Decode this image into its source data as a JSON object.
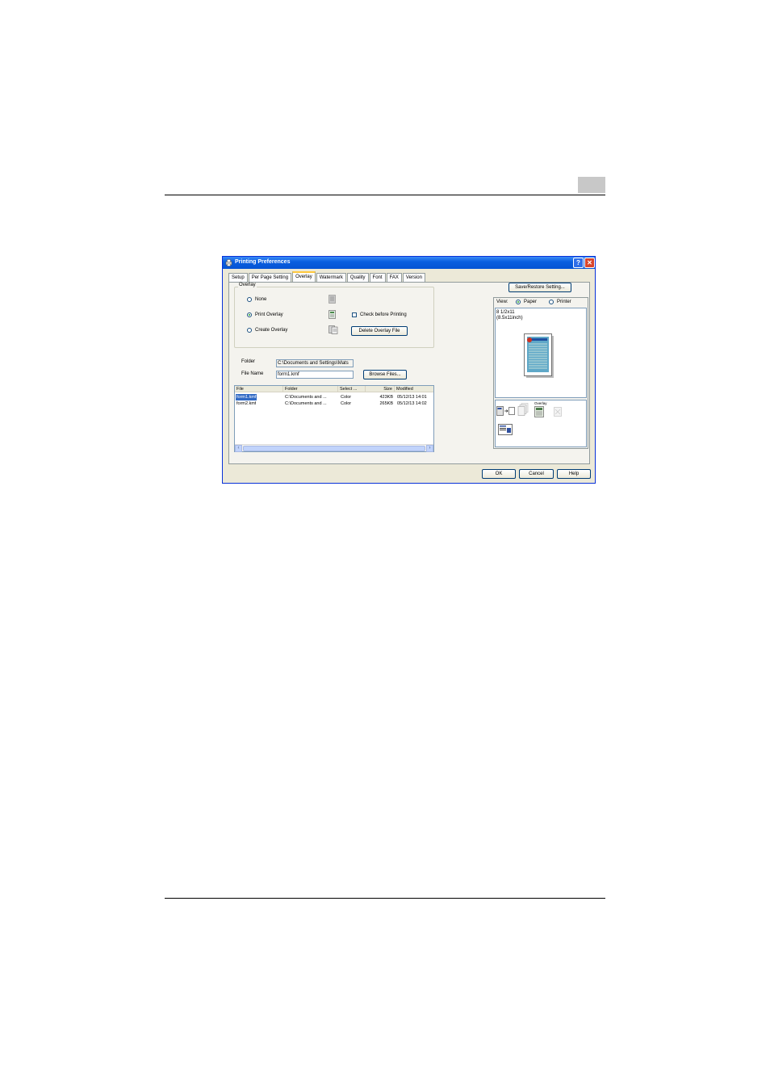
{
  "window": {
    "title": "Printing Preferences",
    "help_label": "?",
    "close_label": "✕"
  },
  "tabs": [
    {
      "label": "Setup"
    },
    {
      "label": "Per Page Setting"
    },
    {
      "label": "Overlay"
    },
    {
      "label": "Watermark"
    },
    {
      "label": "Quality"
    },
    {
      "label": "Font"
    },
    {
      "label": "FAX"
    },
    {
      "label": "Version"
    }
  ],
  "overlay": {
    "group_label": "Overlay",
    "options": [
      {
        "label": "None",
        "selected": false
      },
      {
        "label": "Print Overlay",
        "selected": true
      },
      {
        "label": "Create Overlay",
        "selected": false
      }
    ],
    "check_before_printing": "Check before Printing",
    "delete_button": "Delete Overlay File"
  },
  "folder": {
    "label": "Folder",
    "value": "C:\\Documents and Settings\\Mats"
  },
  "file_name": {
    "label": "File Name",
    "value": "form1.kmf",
    "browse_button": "Browse Files..."
  },
  "file_list": {
    "columns": [
      "File",
      "Folder",
      "Select ...",
      "Size",
      "Modified"
    ],
    "rows": [
      {
        "file": "form1.kmf",
        "folder": "C:\\Documents and ...",
        "select": "Color",
        "size": "423KB",
        "modified": "05/12/13 14:01",
        "selected": true
      },
      {
        "file": "form2.kmf",
        "folder": "C:\\Documents and ...",
        "select": "Color",
        "size": "265KB",
        "modified": "05/12/13 14:02",
        "selected": false
      }
    ]
  },
  "right_panel": {
    "save_restore_button": "Save/Restore Setting...",
    "view_label": "View:",
    "view_options": [
      {
        "label": "Paper",
        "selected": true
      },
      {
        "label": "Printer",
        "selected": false
      }
    ],
    "paper_size_line1": "8 1/2x11",
    "paper_size_line2": "(8.5x11inch)",
    "func_overlay_label": "Overlay"
  },
  "footer": {
    "ok": "OK",
    "cancel": "Cancel",
    "help": "Help"
  },
  "colors": {
    "titlebar": "#0a5fe0",
    "dialog_bg": "#ece9d8",
    "selection": "#316ac5"
  }
}
